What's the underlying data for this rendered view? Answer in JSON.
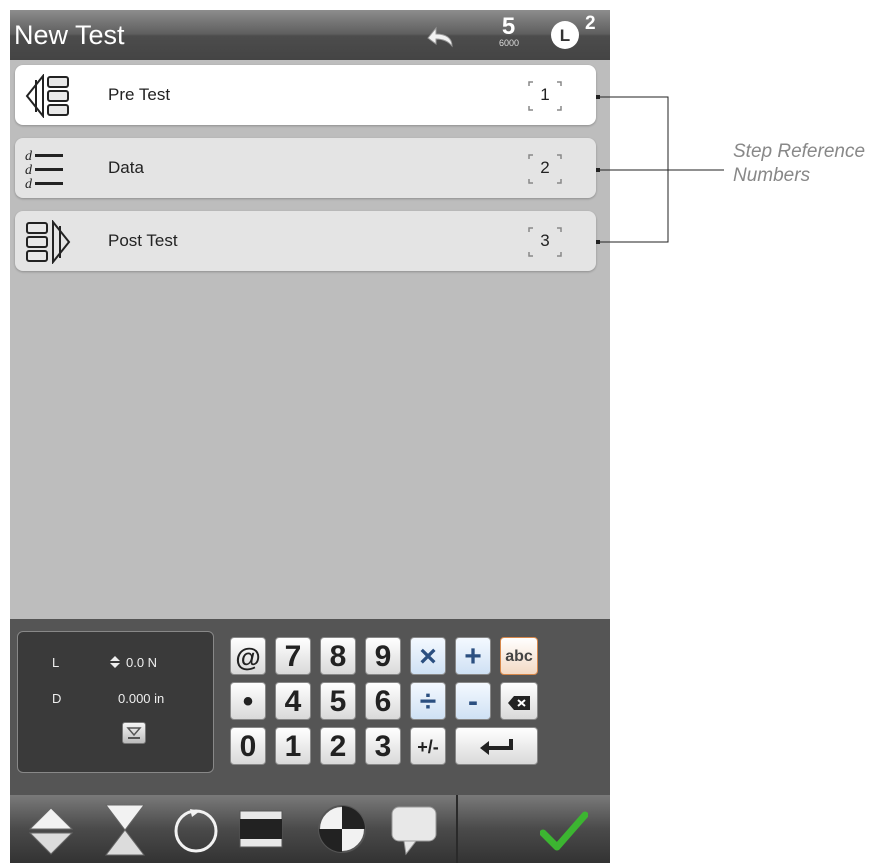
{
  "header": {
    "title": "New Test",
    "speed_digit": "5",
    "speed_sub": "6000",
    "load_count": "2"
  },
  "steps": [
    {
      "label": "Pre Test",
      "number": "1",
      "selected": true,
      "icon": "pre-test-icon"
    },
    {
      "label": "Data",
      "number": "2",
      "selected": false,
      "icon": "data-icon"
    },
    {
      "label": "Post Test",
      "number": "3",
      "selected": false,
      "icon": "post-test-icon"
    }
  ],
  "readout": {
    "load_label": "L",
    "load_value": "0.0 N",
    "disp_label": "D",
    "disp_value": "0.000 in"
  },
  "keypad": {
    "row1": [
      "@",
      "7",
      "8",
      "9",
      "×",
      "+",
      "abc"
    ],
    "row2": [
      "•",
      "4",
      "5",
      "6",
      "÷",
      "-",
      "backspace"
    ],
    "row3": [
      "0",
      "1",
      "2",
      "3",
      "+/-",
      "enter"
    ]
  },
  "toolbar": {
    "tools": [
      "up-down-arrows-icon",
      "hourglass-icon",
      "circle-icon",
      "rectangle-icon",
      "target-icon",
      "speech-bubble-icon"
    ],
    "confirm": "checkmark-icon"
  },
  "annotation": {
    "text": "Step Reference Numbers"
  },
  "colors": {
    "accent_check": "#3cb531",
    "abc_key_border": "#d6874a",
    "op_key": "#2b4f80"
  }
}
